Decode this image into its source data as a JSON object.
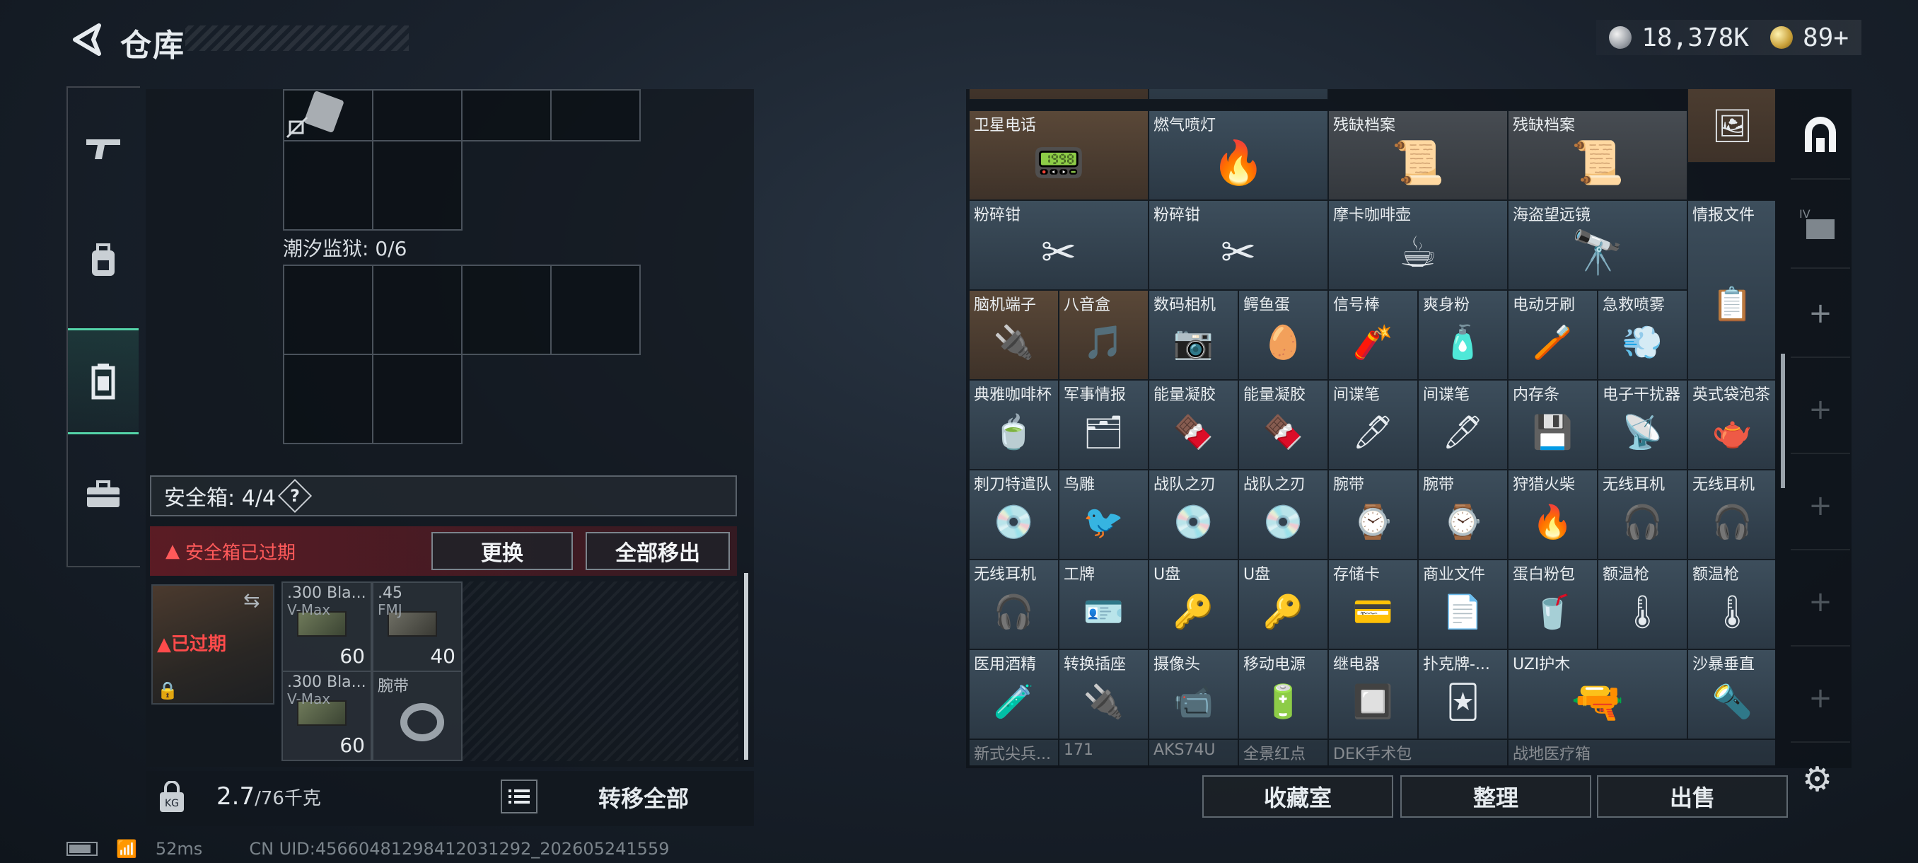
{
  "header": {
    "title": "仓库",
    "currency": [
      {
        "name": "silver-coin-icon",
        "value": "18,378K"
      },
      {
        "name": "gold-coin-icon",
        "value": "89+"
      }
    ]
  },
  "nav": {
    "items": [
      "gun-icon",
      "backpack-icon",
      "vest-icon",
      "briefcase-icon"
    ],
    "active_index": 2
  },
  "left": {
    "tide_prison_label": "潮汐监狱: 0/6",
    "safe_box_label": "安全箱: 4/4",
    "help_mark": "?",
    "expired_notice": "安全箱已过期",
    "replace_button": "更换",
    "move_all_button": "全部移出",
    "case_expired": "已过期",
    "slots": [
      {
        "name": ".300 Bla...",
        "sub": "V-Max",
        "count": "60"
      },
      {
        "name": ".45",
        "sub": "FMJ",
        "count": "40"
      },
      {
        "name": ".300 Bla...",
        "sub": "V-Max",
        "count": "60"
      },
      {
        "name": "腕带",
        "sub": "",
        "count": ""
      }
    ],
    "weight_value": "2.7",
    "weight_max": "/76千克",
    "transfer_all_button": "转移全部"
  },
  "items": [
    {
      "label": "卫星电话",
      "icon": "📟",
      "style": "brown"
    },
    {
      "label": "燃气喷灯",
      "icon": "🔥",
      "style": ""
    },
    {
      "label": "残缺档案",
      "icon": "📜",
      "style": "gray"
    },
    {
      "label": "残缺档案",
      "icon": "📜",
      "style": "gray"
    },
    {
      "label": "粉碎钳",
      "icon": "✂",
      "style": ""
    },
    {
      "label": "粉碎钳",
      "icon": "✂",
      "style": ""
    },
    {
      "label": "摩卡咖啡壶",
      "icon": "☕",
      "style": ""
    },
    {
      "label": "海盗望远镜",
      "icon": "🔭",
      "style": ""
    },
    {
      "label": "情报文件",
      "icon": "📋",
      "style": ""
    },
    {
      "label": "脑机端子",
      "icon": "🔌",
      "style": "brown"
    },
    {
      "label": "八音盒",
      "icon": "🎵",
      "style": "brown"
    },
    {
      "label": "数码相机",
      "icon": "📷",
      "style": ""
    },
    {
      "label": "鳄鱼蛋",
      "icon": "🥚",
      "style": ""
    },
    {
      "label": "信号棒",
      "icon": "🧨",
      "style": ""
    },
    {
      "label": "爽身粉",
      "icon": "🧴",
      "style": ""
    },
    {
      "label": "电动牙刷",
      "icon": "🪥",
      "style": ""
    },
    {
      "label": "急救喷雾",
      "icon": "💨",
      "style": ""
    },
    {
      "label": "典雅咖啡杯",
      "icon": "🍵",
      "style": ""
    },
    {
      "label": "军事情报",
      "icon": "🗂",
      "style": ""
    },
    {
      "label": "能量凝胶",
      "icon": "🍫",
      "style": ""
    },
    {
      "label": "能量凝胶",
      "icon": "🍫",
      "style": ""
    },
    {
      "label": "间谍笔",
      "icon": "🖊",
      "style": ""
    },
    {
      "label": "间谍笔",
      "icon": "🖊",
      "style": ""
    },
    {
      "label": "内存条",
      "icon": "💾",
      "style": ""
    },
    {
      "label": "电子干扰器",
      "icon": "📡",
      "style": ""
    },
    {
      "label": "英式袋泡茶",
      "icon": "🫖",
      "style": ""
    },
    {
      "label": "刺刀特遣队",
      "icon": "💿",
      "style": ""
    },
    {
      "label": "鸟雕",
      "icon": "🐦",
      "style": ""
    },
    {
      "label": "战队之刃",
      "icon": "💿",
      "style": ""
    },
    {
      "label": "战队之刃",
      "icon": "💿",
      "style": ""
    },
    {
      "label": "腕带",
      "icon": "⌚",
      "style": ""
    },
    {
      "label": "腕带",
      "icon": "⌚",
      "style": ""
    },
    {
      "label": "狩猎火柴",
      "icon": "🔥",
      "style": ""
    },
    {
      "label": "无线耳机",
      "icon": "🎧",
      "style": ""
    },
    {
      "label": "无线耳机",
      "icon": "🎧",
      "style": ""
    },
    {
      "label": "无线耳机",
      "icon": "🎧",
      "style": ""
    },
    {
      "label": "工牌",
      "icon": "🪪",
      "style": ""
    },
    {
      "label": "U盘",
      "icon": "🔑",
      "style": ""
    },
    {
      "label": "U盘",
      "icon": "🔑",
      "style": ""
    },
    {
      "label": "存储卡",
      "icon": "💳",
      "style": ""
    },
    {
      "label": "商业文件",
      "icon": "📄",
      "style": ""
    },
    {
      "label": "蛋白粉包",
      "icon": "🥤",
      "style": ""
    },
    {
      "label": "额温枪",
      "icon": "🌡",
      "style": ""
    },
    {
      "label": "额温枪",
      "icon": "🌡",
      "style": ""
    },
    {
      "label": "医用酒精",
      "icon": "🧪",
      "style": ""
    },
    {
      "label": "转换插座",
      "icon": "🔌",
      "style": ""
    },
    {
      "label": "摄像头",
      "icon": "📹",
      "style": ""
    },
    {
      "label": "移动电源",
      "icon": "🔋",
      "style": ""
    },
    {
      "label": "继电器",
      "icon": "🔲",
      "style": ""
    },
    {
      "label": "扑克牌-...",
      "icon": "🃏",
      "style": ""
    },
    {
      "label": "UZI护木",
      "icon": "🔫",
      "style": ""
    },
    {
      "label": "沙暴垂直",
      "icon": "🔦",
      "style": ""
    },
    {
      "label": "新式尖兵...",
      "icon": "",
      "style": "dim"
    },
    {
      "label": "171",
      "icon": "",
      "style": "dim"
    },
    {
      "label": "AKS74U",
      "icon": "",
      "style": "dim"
    },
    {
      "label": "全景红点",
      "icon": "",
      "style": "dim"
    },
    {
      "label": "DEK手术包",
      "icon": "",
      "style": "dim"
    },
    {
      "label": "战地医疗箱",
      "icon": "",
      "style": "dim"
    }
  ],
  "right_rail": [
    "house-icon",
    "folder-iv-icon",
    "add-icon",
    "add-icon",
    "add-icon",
    "add-icon",
    "add-icon"
  ],
  "right_buttons": {
    "collection": "收藏室",
    "organize": "整理",
    "sell": "出售"
  },
  "status": {
    "ping": "52ms",
    "uid": "CN UID:45660481298412031292_202605241559"
  }
}
